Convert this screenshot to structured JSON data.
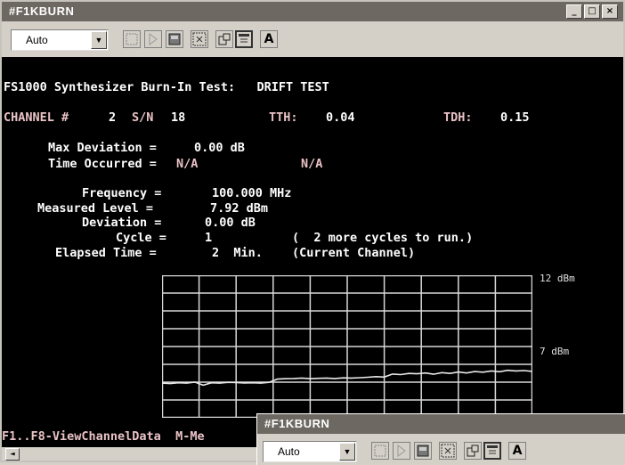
{
  "window": {
    "title": "#F1KBURN",
    "controls": [
      "_",
      "□",
      "×"
    ]
  },
  "toolbar": {
    "font_select": "Auto",
    "icons": [
      "border-frame-icon",
      "select-arrow-icon",
      "copy-icon",
      "full-screen-icon",
      "properties-icon",
      "background-icon",
      "font-icon"
    ],
    "font_label": "A"
  },
  "screen": {
    "title": "FS1000 Synthesizer Burn-In Test:   DRIFT TEST",
    "channel_line": {
      "channel_label": "CHANNEL #",
      "channel_value": "2",
      "sn_label": "S/N",
      "sn_value": "18",
      "tth_label": "TTH:",
      "tth_value": "0.04",
      "tdh_label": "TDH:",
      "tdh_value": "0.15"
    },
    "max_deviation": {
      "label": "Max Deviation =",
      "value": "0.00 dB"
    },
    "time_occurred": {
      "label": "Time Occurred =",
      "value1": "N/A",
      "value2": "N/A"
    },
    "frequency": {
      "label": "Frequency =",
      "value": "100.000 MHz"
    },
    "measured_level": {
      "label": "Measured Level =",
      "value": "7.92 dBm"
    },
    "deviation": {
      "label": "Deviation =",
      "value": "0.00 dB"
    },
    "cycle": {
      "label": "Cycle =",
      "value": "1",
      "note": "(  2 more cycles to run.)"
    },
    "elapsed": {
      "label": "Elapsed Time =",
      "value": "2  Min.",
      "note": "(Current Channel)"
    },
    "fkeys": "F1..F8-ViewChannelData  M-Me"
  },
  "chart_data": {
    "type": "line",
    "title": "",
    "xlabel": "",
    "ylabel": "",
    "y_tick_labels": [
      "12 dBm",
      "7 dBm"
    ],
    "ylim": [
      5,
      12
    ],
    "grid": true,
    "series": [
      {
        "color": "#e8e8e8",
        "values": [
          6.7,
          6.68,
          6.72,
          6.7,
          6.75,
          6.6,
          6.72,
          6.7,
          6.74,
          6.73,
          6.71,
          6.72,
          6.7,
          6.74,
          6.9,
          6.92,
          6.93,
          6.95,
          6.92,
          6.94,
          6.95,
          6.93,
          6.96,
          6.95,
          6.97,
          6.99,
          7.02,
          7.0,
          7.15,
          7.12,
          7.18,
          7.16,
          7.2,
          7.14,
          7.22,
          7.18,
          7.25,
          7.2,
          7.27,
          7.24,
          7.3,
          7.26,
          7.33,
          7.3,
          7.32,
          7.28
        ]
      }
    ]
  },
  "mini_window": {
    "title": "#F1KBURN",
    "font_select": "Auto",
    "font_label": "A"
  }
}
